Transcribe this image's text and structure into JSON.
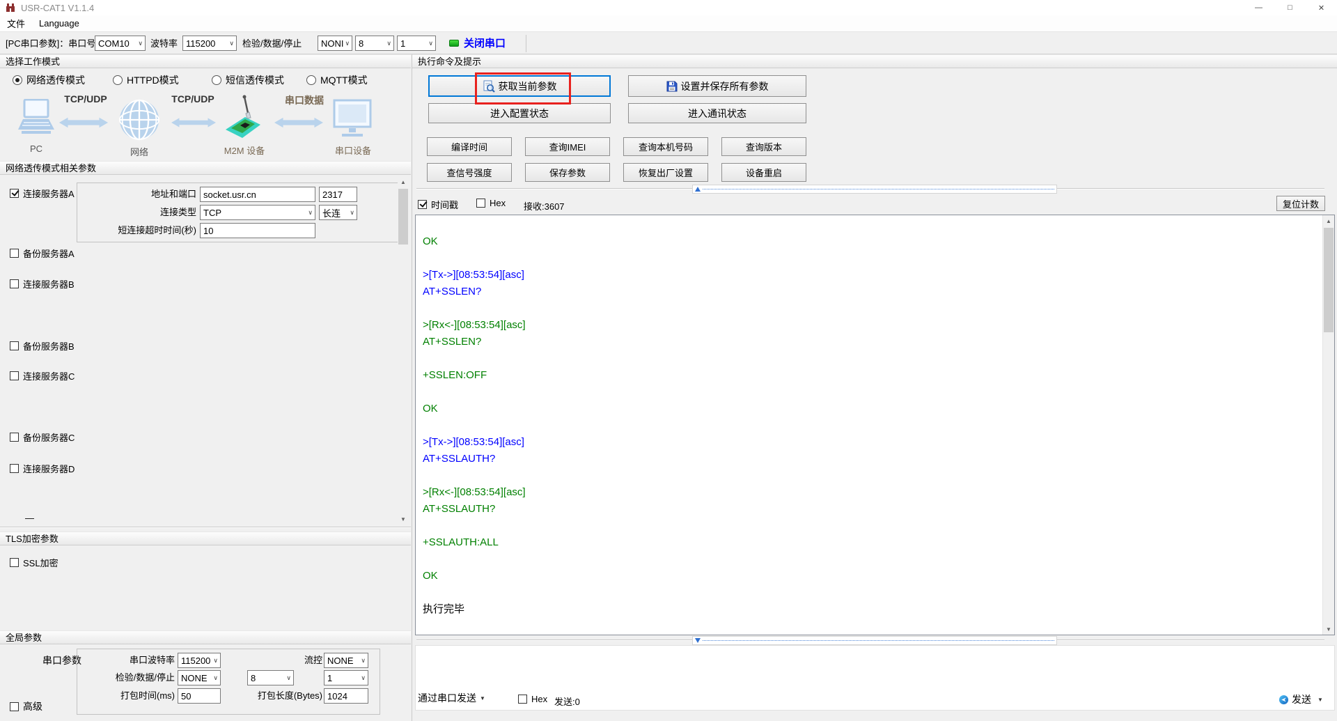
{
  "window": {
    "title": "USR-CAT1 V1.1.4"
  },
  "icons": {
    "minimize": "—",
    "maximize": "□",
    "close": "✕",
    "scroll_up": "▲",
    "scroll_down": "▼"
  },
  "colors": {
    "terminal_green": "#008000",
    "terminal_blue": "#0000ff",
    "annotation_red": "#e8221f",
    "focus_blue": "#0078d7",
    "link_blue": "#0000ff",
    "status_green": "#0c9c18"
  },
  "menu_bar": {
    "items": [
      "文件",
      "Language"
    ]
  },
  "toolbar": {
    "port_label": "[PC串口参数]：串口号",
    "port_value": "COM10",
    "baud_label": "波特率",
    "baud_value": "115200",
    "parity_label": "检验/数据/停止",
    "parity_value": "NONI",
    "data_bits": "8",
    "stop_bits": "1",
    "close_port_label": "关闭串口"
  },
  "work_mode": {
    "header": "选择工作模式",
    "options": [
      {
        "label": "网络透传模式",
        "selected": true
      },
      {
        "label": "HTTPD模式",
        "selected": false
      },
      {
        "label": "短信透传模式",
        "selected": false
      },
      {
        "label": "MQTT模式",
        "selected": false
      }
    ]
  },
  "diagram": {
    "pc_label": "PC",
    "network_label": "网络",
    "m2m_label": "M2M 设备",
    "serial_label": "串口设备",
    "link1": "TCP/UDP",
    "link2": "TCP/UDP",
    "link3": "串口数据"
  },
  "net_params": {
    "header": "网络透传模式相关参数",
    "server_a": {
      "label": "连接服务器A",
      "addr_label": "地址和端口",
      "addr": "socket.usr.cn",
      "port": "2317",
      "type_label": "连接类型",
      "type": "TCP",
      "conn_mode": "长连",
      "timeout_label": "短连接超时时间(秒)",
      "timeout": "10"
    },
    "other_servers": [
      {
        "label": "备份服务器A"
      },
      {
        "label": "连接服务器B"
      },
      {
        "label": "备份服务器B"
      },
      {
        "label": "连接服务器C"
      },
      {
        "label": "备份服务器C"
      },
      {
        "label": "连接服务器D"
      }
    ],
    "dash": "—"
  },
  "tls": {
    "header": "TLS加密参数",
    "ssl_label": "SSL加密"
  },
  "global_params": {
    "header": "全局参数",
    "group_label": "串口参数",
    "baud_label": "串口波特率",
    "baud": "115200",
    "flow_label": "流控",
    "flow": "NONE",
    "parity_label": "检验/数据/停止",
    "parity": "NONE",
    "data_bits": "8",
    "stop_bits": "1",
    "pack_time_label": "打包时间(ms)",
    "pack_time": "50",
    "pack_len_label": "打包长度(Bytes)",
    "pack_len": "1024",
    "advanced_label": "高级"
  },
  "exec_panel": {
    "header": "执行命令及提示",
    "get_params": "获取当前参数",
    "set_save": "设置并保存所有参数",
    "enter_config": "进入配置状态",
    "enter_comm": "进入通讯状态",
    "small_buttons": [
      "编译时间",
      "查询IMEI",
      "查询本机号码",
      "查询版本",
      "查信号强度",
      "保存参数",
      "恢复出厂设置",
      "设备重启"
    ],
    "timestamp_label": "时间戳",
    "hex_label": "Hex",
    "recv_label": "接收:3607",
    "reset_count": "复位计数",
    "terminal_lines": [
      {
        "text": "OK",
        "color": "green"
      },
      {
        "text": "",
        "color": ""
      },
      {
        "text": ">[Tx->][08:53:54][asc]",
        "color": "blue"
      },
      {
        "text": "AT+SSLEN?",
        "color": "blue"
      },
      {
        "text": "",
        "color": ""
      },
      {
        "text": ">[Rx<-][08:53:54][asc]",
        "color": "green"
      },
      {
        "text": "AT+SSLEN?",
        "color": "green"
      },
      {
        "text": "",
        "color": ""
      },
      {
        "text": "+SSLEN:OFF",
        "color": "green"
      },
      {
        "text": "",
        "color": ""
      },
      {
        "text": "OK",
        "color": "green"
      },
      {
        "text": "",
        "color": ""
      },
      {
        "text": ">[Tx->][08:53:54][asc]",
        "color": "blue"
      },
      {
        "text": "AT+SSLAUTH?",
        "color": "blue"
      },
      {
        "text": "",
        "color": ""
      },
      {
        "text": ">[Rx<-][08:53:54][asc]",
        "color": "green"
      },
      {
        "text": "AT+SSLAUTH?",
        "color": "green"
      },
      {
        "text": "",
        "color": ""
      },
      {
        "text": "+SSLAUTH:ALL",
        "color": "green"
      },
      {
        "text": "",
        "color": ""
      },
      {
        "text": "OK",
        "color": "green"
      },
      {
        "text": "",
        "color": ""
      },
      {
        "text": "执行完毕",
        "color": "black"
      }
    ],
    "send_bar": {
      "via_serial": "通过串口发送",
      "hex_label": "Hex",
      "sent_label": "发送:0",
      "send_button": "发送"
    }
  }
}
